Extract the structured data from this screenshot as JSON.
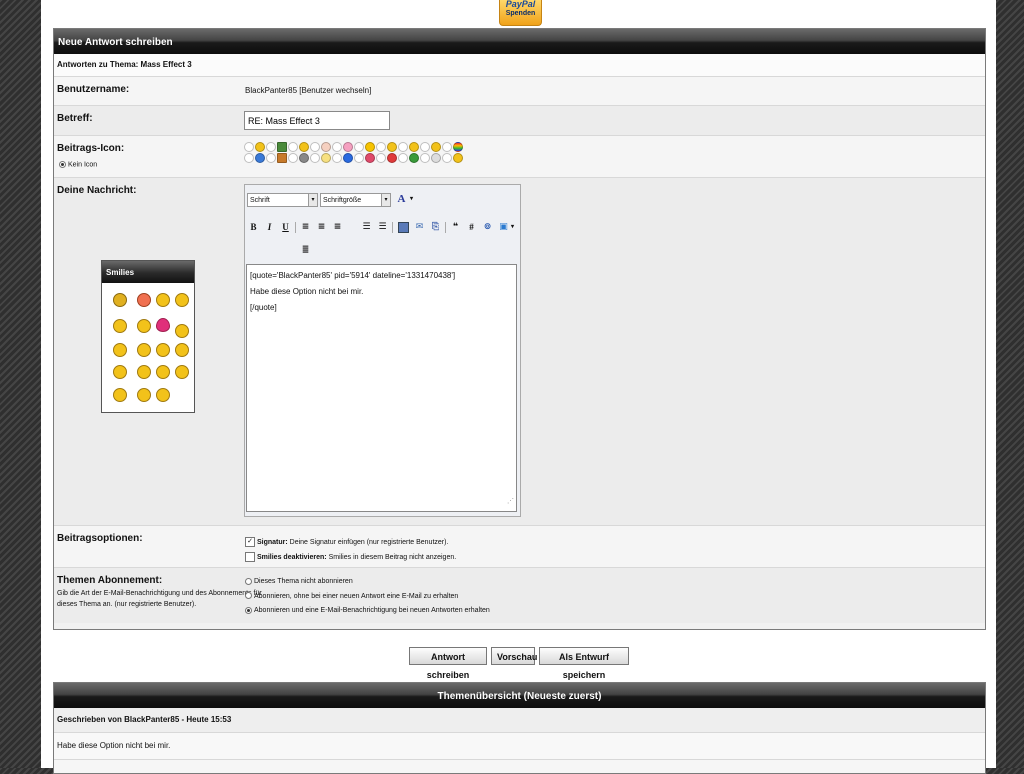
{
  "paypal": {
    "brand": "PayPal",
    "label": "Spenden"
  },
  "reply_form": {
    "title": "Neue Antwort schreiben",
    "subtitle": "Antworten zu Thema: Mass Effect 3",
    "username": {
      "label": "Benutzername:",
      "value": "BlackPanter85",
      "switch": "[Benutzer wechseln]"
    },
    "subject": {
      "label": "Betreff:",
      "value": "RE: Mass Effect 3"
    },
    "post_icon": {
      "label": "Beitrags-Icon:",
      "none_label": "Kein Icon"
    },
    "message": {
      "label": "Deine Nachricht:",
      "font_select": "Schrift",
      "size_select": "Schriftgröße",
      "text_lines": [
        "[quote='BlackPanter85' pid='5914' dateline='1331470438']",
        "Habe diese Option nicht bei mir.",
        "[/quote]"
      ]
    },
    "smilies": {
      "title": "Smilies"
    },
    "options": {
      "label": "Beitragsoptionen:",
      "signature_bold": "Signatur:",
      "signature_text": "Deine Signatur einfügen (nur registrierte Benutzer).",
      "signature_checked": true,
      "smilies_bold": "Smilies deaktivieren:",
      "smilies_text": "Smilies in diesem Beitrag nicht anzeigen.",
      "smilies_checked": false
    },
    "subscription": {
      "label": "Themen Abonnement:",
      "desc_lines": [
        "Gib die Art der E-Mail-Benachrichtigung und des Abonnements für",
        "dieses Thema an. (nur registrierte Benutzer)."
      ],
      "choices": [
        "Dieses Thema nicht abonnieren",
        "Abonnieren, ohne bei einer neuen Antwort eine E-Mail zu erhalten",
        "Abonnieren und eine E-Mail-Benachrichtigung bei neuen Antworten erhalten"
      ],
      "selected": 2
    }
  },
  "buttons": {
    "submit": "Antwort schreiben",
    "preview": "Vorschau",
    "draft": "Als Entwurf speichern"
  },
  "overview": {
    "title": "Themenübersicht (Neueste zuerst)",
    "post_header": "Geschrieben von BlackPanter85 - Heute 15:53",
    "post_text": "Habe diese Option nicht bei mir."
  },
  "colors": {
    "header_bar": "#1a1a1a",
    "accent_link": "#1a4a9a",
    "smiley_yellow": "#f2c21a"
  }
}
